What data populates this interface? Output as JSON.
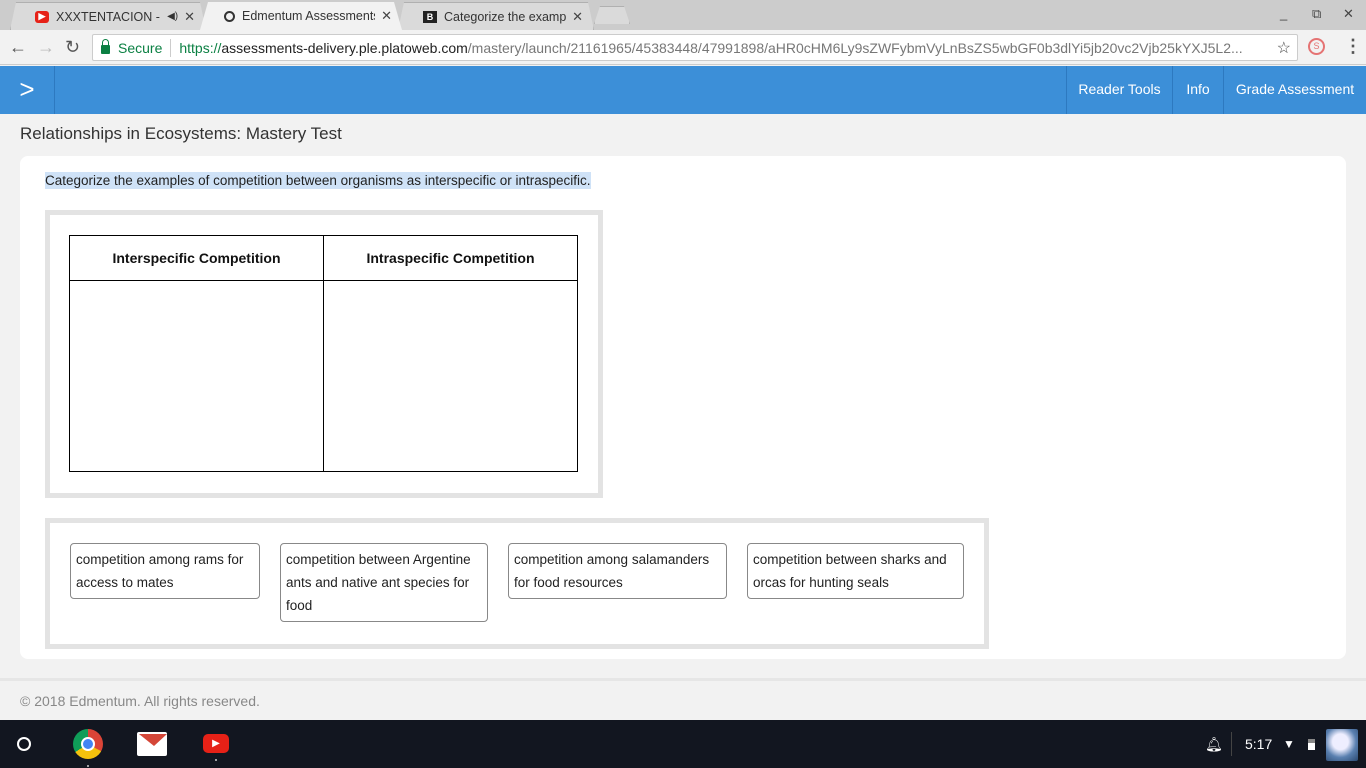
{
  "browser": {
    "tabs": [
      {
        "title": "XXXTENTACION - #Ir",
        "icon": "youtube-icon",
        "audio": true
      },
      {
        "title": "Edmentum Assessments",
        "icon": "edmentum-icon",
        "active": true
      },
      {
        "title": "Categorize the examples",
        "icon": "brainly-icon"
      }
    ],
    "secure_label": "Secure",
    "url_scheme": "https://",
    "url_host": "assessments-delivery.ple.platoweb.com",
    "url_path": "/mastery/launch/21161965/45383448/47991898/aHR0cHM6Ly9sZWFybmVyLnBsZS5wbGF0b3dlYi5jb20vc2Vjb25kYXJ5L2..."
  },
  "appbar": {
    "buttons": [
      "Reader Tools",
      "Info",
      "Grade Assessment"
    ],
    "color": "#3c8fd8"
  },
  "page": {
    "title": "Relationships in Ecosystems: Mastery Test",
    "prompt": "Categorize the examples of competition between organisms as interspecific or intraspecific.",
    "columns": [
      "Interspecific Competition",
      "Intraspecific Competition"
    ],
    "choices": [
      "competition among rams for access to mates",
      "competition between Argentine ants and native ant species for food",
      "competition among salamanders for food resources",
      "competition between sharks and orcas for hunting seals"
    ]
  },
  "footer": {
    "copyright": "© 2018 Edmentum. All rights reserved."
  },
  "shelf": {
    "time": "5:17",
    "apps": [
      "chrome-icon",
      "gmail-icon",
      "youtube-icon"
    ]
  }
}
